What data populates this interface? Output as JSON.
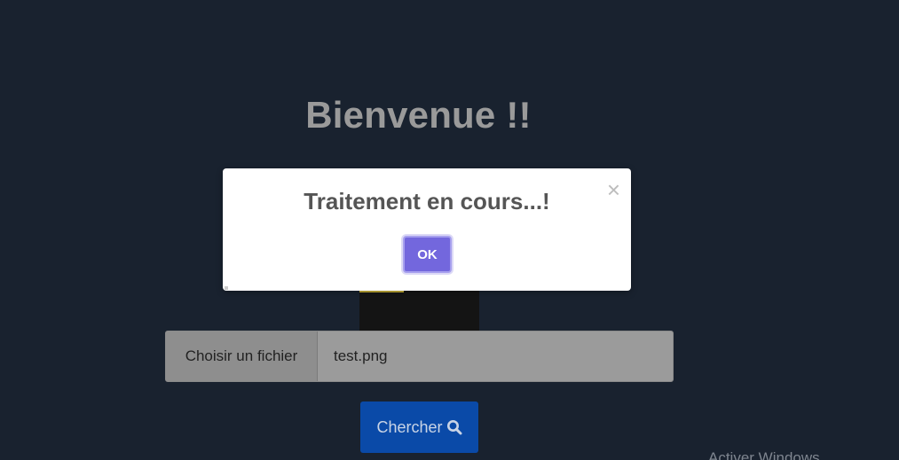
{
  "page": {
    "title": "Bienvenue !!"
  },
  "file_input": {
    "button_label": "Choisir un fichier",
    "file_name": "test.png"
  },
  "search": {
    "button_label": "Chercher",
    "icon": "search-icon"
  },
  "modal": {
    "title": "Traitement en cours...!",
    "ok_label": "OK",
    "close_glyph": "×"
  },
  "watermark": {
    "text": "Activer Windows"
  },
  "colors": {
    "background": "#19222f",
    "modal_ok": "#7367dd",
    "search_button": "#0a4aa8"
  }
}
